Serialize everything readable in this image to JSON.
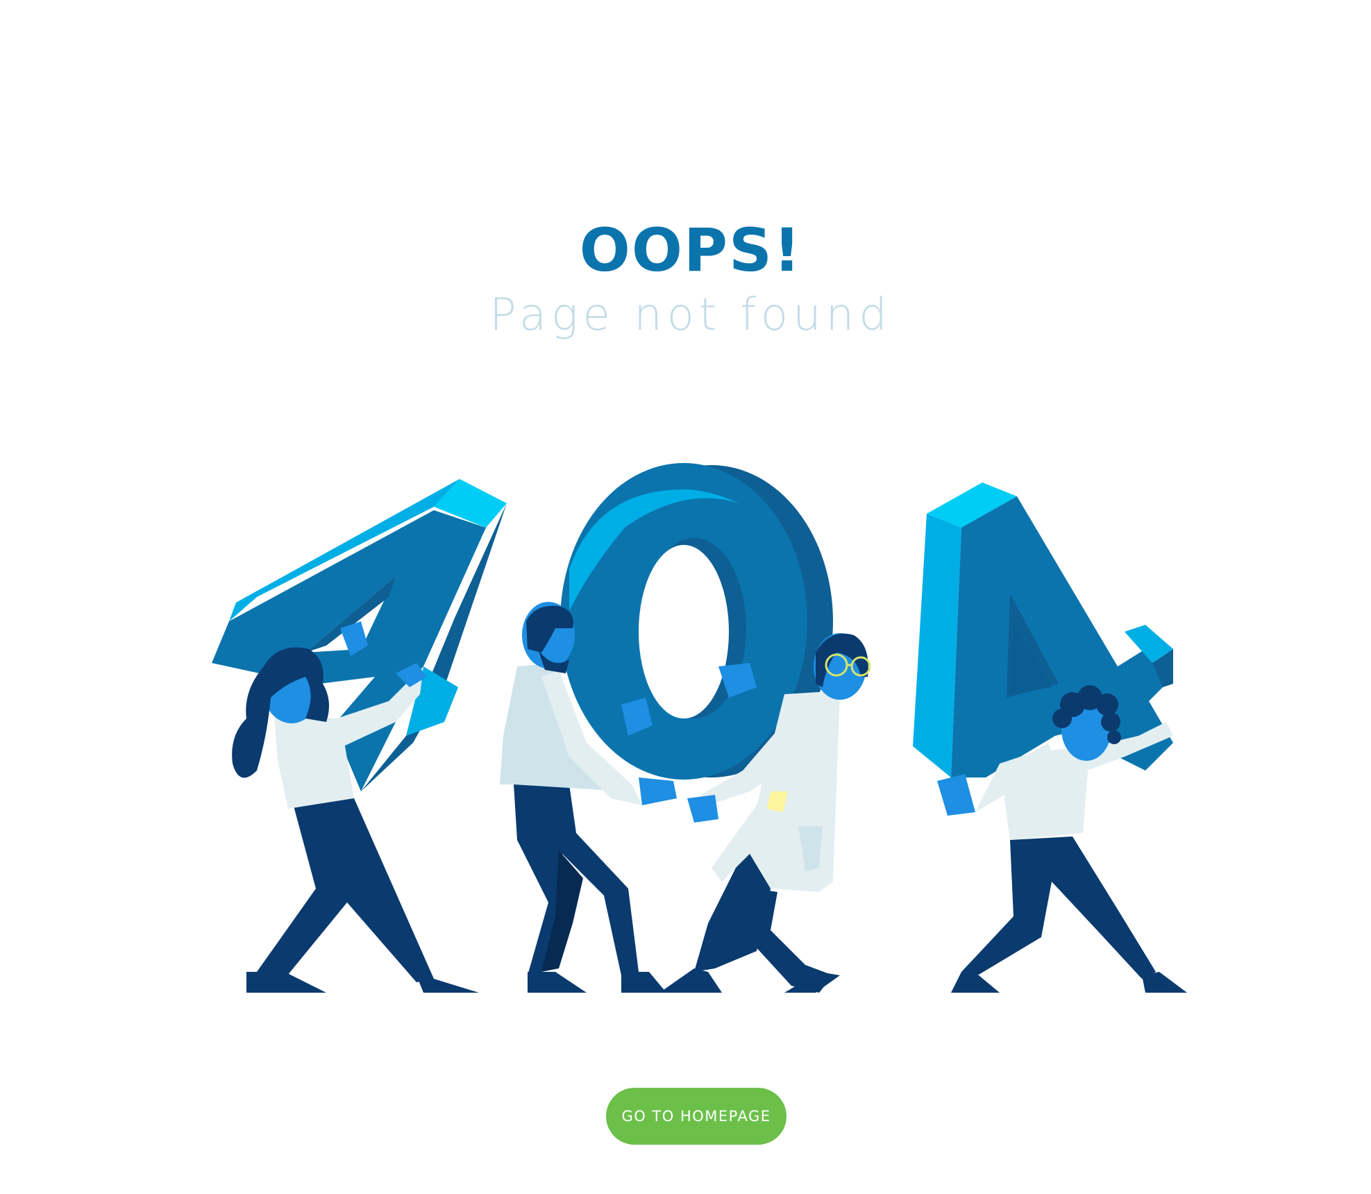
{
  "header": {
    "title": "OOPS!",
    "subtitle": "Page not found"
  },
  "illustration": {
    "digits": [
      "4",
      "0",
      "4"
    ]
  },
  "cta": {
    "label": "GO TO HOMEPAGE"
  },
  "colors": {
    "title": "#0c74ad",
    "subtitle": "#c2dbe6",
    "digit_front": "#0b74ad",
    "digit_top": "#00cdf5",
    "digit_side": "#0e5f94",
    "pants": "#0a3a6e",
    "skin": "#1e8fe3",
    "shirt": "#e3eef1",
    "button": "#6cc04a"
  }
}
